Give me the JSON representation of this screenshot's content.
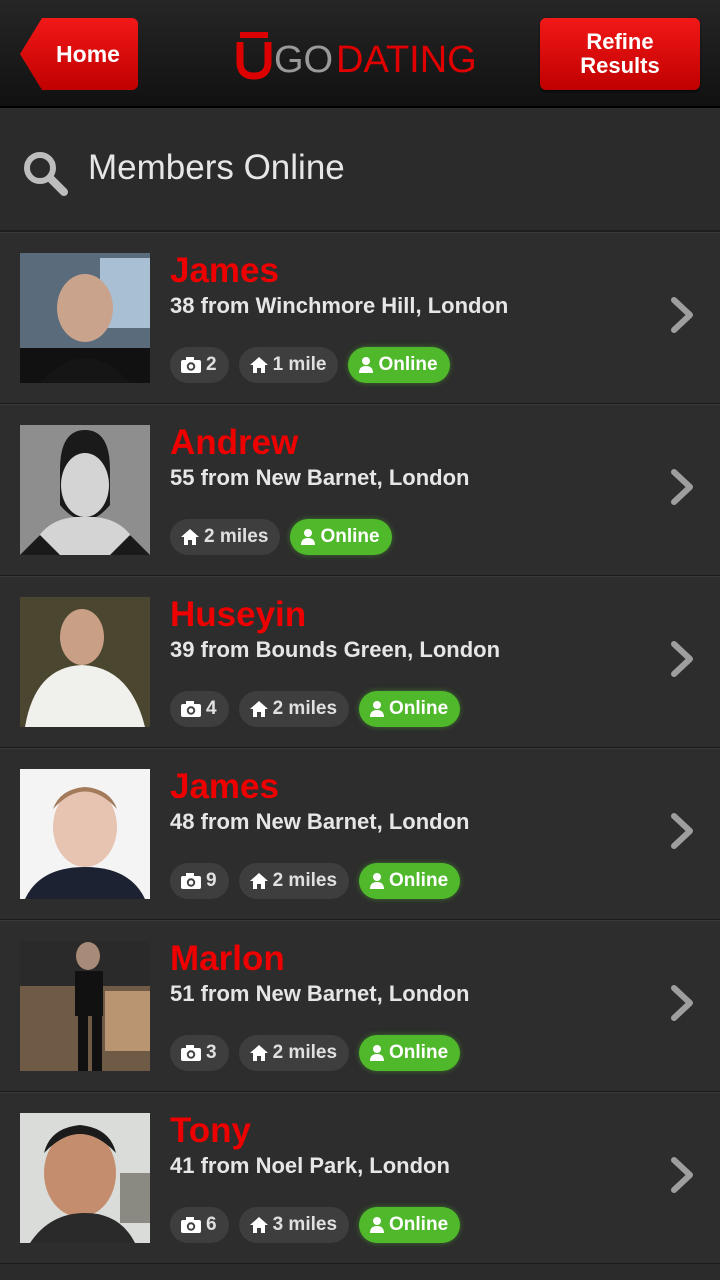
{
  "header": {
    "home_label": "Home",
    "refine_label_line1": "Refine",
    "refine_label_line2": "Results",
    "logo_prefix": "GO",
    "logo_suffix": "DATING",
    "brand_red": "#e00000"
  },
  "search": {
    "title": "Members Online"
  },
  "members": [
    {
      "name": "James",
      "details": "38 from Winchmore Hill, London",
      "photos": "2",
      "distance": "1 mile",
      "status": "Online",
      "avatar": "photo-man-dark-shirt"
    },
    {
      "name": "Andrew",
      "details": "55 from New Barnet, London",
      "photos": "",
      "distance": "2 miles",
      "status": "Online",
      "avatar": "silhouette"
    },
    {
      "name": "Huseyin",
      "details": "39 from Bounds Green, London",
      "photos": "4",
      "distance": "2 miles",
      "status": "Online",
      "avatar": "photo-man-white-shirt"
    },
    {
      "name": "James",
      "details": "48 from New Barnet, London",
      "photos": "9",
      "distance": "2 miles",
      "status": "Online",
      "avatar": "photo-man-blazer"
    },
    {
      "name": "Marlon",
      "details": "51 from New Barnet, London",
      "photos": "3",
      "distance": "2 miles",
      "status": "Online",
      "avatar": "photo-man-gym"
    },
    {
      "name": "Tony",
      "details": "41 from Noel Park, London",
      "photos": "6",
      "distance": "3 miles",
      "status": "Online",
      "avatar": "photo-man-outdoor"
    }
  ]
}
